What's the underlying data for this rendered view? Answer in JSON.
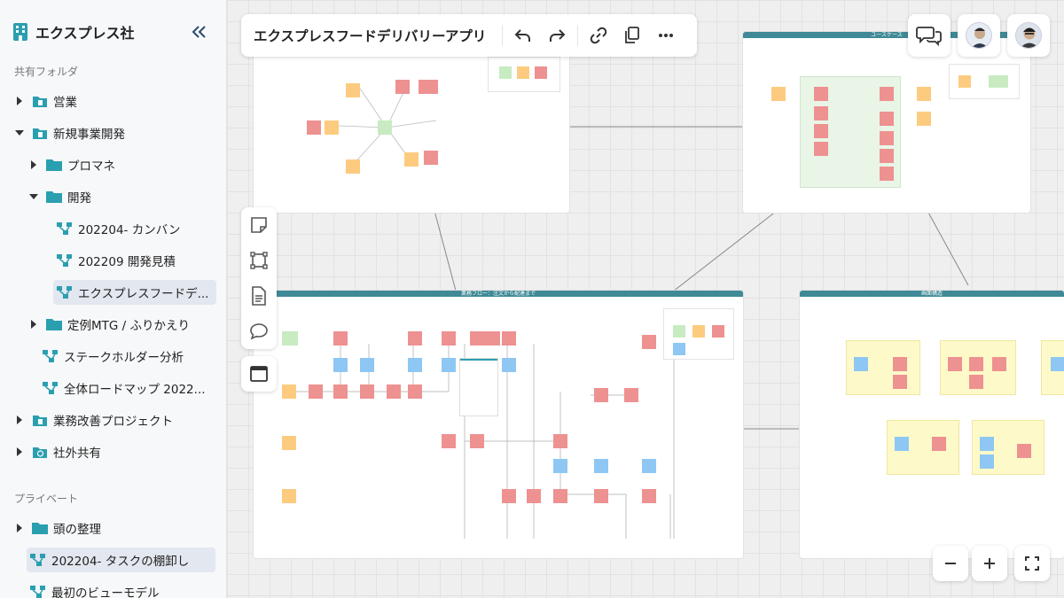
{
  "sidebar": {
    "brand": "エクスプレス社",
    "shared_label": "共有フォルダ",
    "private_label": "プライベート",
    "items": [
      {
        "label": "営業"
      },
      {
        "label": "新規事業開発"
      },
      {
        "label": "プロマネ"
      },
      {
        "label": "開発"
      },
      {
        "label": "202204- カンバン"
      },
      {
        "label": "202209 開発見積"
      },
      {
        "label": "エクスプレスフードデ..."
      },
      {
        "label": "定例MTG / ふりかえり"
      },
      {
        "label": "ステークホルダー分析"
      },
      {
        "label": "全体ロードマップ 2022..."
      },
      {
        "label": "業務改善プロジェクト"
      },
      {
        "label": "社外共有"
      },
      {
        "label": "頭の整理"
      },
      {
        "label": "202204- タスクの棚卸し"
      },
      {
        "label": "最初のビューモデル"
      }
    ]
  },
  "board": {
    "title": "エクスプレスフードデリバリーアプリ",
    "frames": {
      "usecase": "ユースケース",
      "flow": "業務フロー：注文から配達まで",
      "screens": "画面構造"
    }
  },
  "colors": {
    "brand": "#2a9fb0",
    "frame_bar": "#3f8a96",
    "note_yellow": "#fdcb7f",
    "note_red": "#ee9191",
    "note_green": "#c8ebc2",
    "note_blue": "#8ec7f3"
  }
}
